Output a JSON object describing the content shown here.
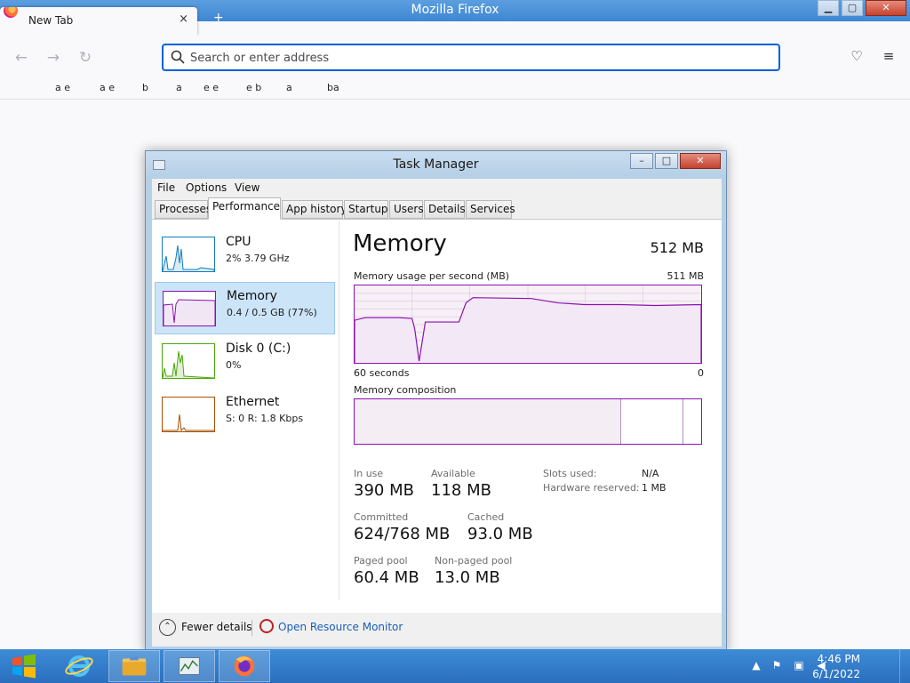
{
  "firefox": {
    "window_title": "Mozilla Firefox",
    "tab_label": "New Tab",
    "tab_close": "×",
    "new_tab": "+",
    "back": "←",
    "forward": "→",
    "reload": "↻",
    "url_placeholder": "Search or enter address",
    "url_value": "",
    "pocket": "♡",
    "menu": "≡",
    "window_controls": {
      "minimize": "▁",
      "maximize": "▢",
      "close": "✕"
    },
    "bookmarks": [
      "a e",
      "a e",
      "b",
      "a",
      "e e",
      "e b",
      "a",
      "ba"
    ]
  },
  "task_manager": {
    "title": "Task Manager",
    "controls": {
      "minimize": "–",
      "maximize": "□",
      "close": "✕"
    },
    "menu": [
      "File",
      "Options",
      "View"
    ],
    "tabs": [
      "Processes",
      "Performance",
      "App history",
      "Startup",
      "Users",
      "Details",
      "Services"
    ],
    "active_tab": "Performance",
    "sidebar": [
      {
        "name": "CPU",
        "sub": "2%  3.79 GHz",
        "color": "#117dbb"
      },
      {
        "name": "Memory",
        "sub": "0.4 / 0.5 GB (77%)",
        "color": "#8b12ae"
      },
      {
        "name": "Disk 0 (C:)",
        "sub": "0%",
        "color": "#4da60c"
      },
      {
        "name": "Ethernet",
        "sub": "S: 0  R: 1.8 Kbps",
        "color": "#a74f01"
      }
    ],
    "memory": {
      "heading": "Memory",
      "total": "512 MB",
      "usage_label": "Memory usage per second (MB)",
      "usage_max": "511 MB",
      "time_left": "60 seconds",
      "time_right": "0",
      "composition_label": "Memory composition",
      "stats": {
        "in_use_label": "In use",
        "in_use": "390 MB",
        "available_label": "Available",
        "available": "118 MB",
        "committed_label": "Committed",
        "committed": "624/768 MB",
        "cached_label": "Cached",
        "cached": "93.0 MB",
        "paged_label": "Paged pool",
        "paged": "60.4 MB",
        "nonpaged_label": "Non-paged pool",
        "nonpaged": "13.0 MB",
        "slots_label": "Slots used:",
        "slots": "N/A",
        "hw_label": "Hardware reserved:",
        "hw": "1 MB"
      }
    },
    "footer": {
      "fewer_icon": "⌃",
      "fewer_details": "Fewer details",
      "resource_monitor": "Open Resource Monitor"
    }
  },
  "taskbar": {
    "time": "4:46 PM",
    "date": "6/1/2022",
    "tray": {
      "chevron": "▲",
      "flag": "⚑",
      "network": "▣",
      "volume": "◀"
    }
  }
}
